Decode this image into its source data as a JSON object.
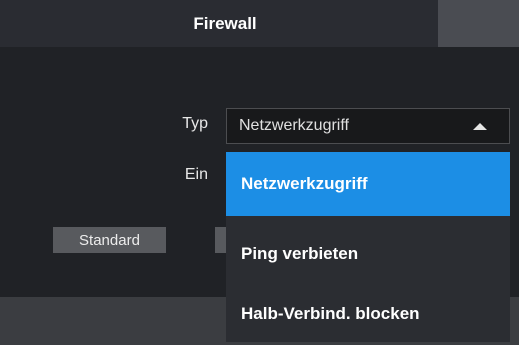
{
  "tabs": {
    "active_label": "Firewall"
  },
  "form": {
    "type_label": "Typ",
    "enable_label": "Ein",
    "type_select": {
      "value": "Netzwerkzugriff"
    }
  },
  "dropdown": {
    "options": [
      {
        "label": "Netzwerkzugriff",
        "selected": true
      },
      {
        "label": "Ping verbieten",
        "selected": false
      },
      {
        "label": "Halb-Verbind. blocken",
        "selected": false
      }
    ]
  },
  "buttons": {
    "standard_label": "Standard",
    "second_label": ""
  },
  "colors": {
    "accent": "#1c8ee5",
    "background": "#202226",
    "dropdown_bg": "#2b2d32"
  }
}
